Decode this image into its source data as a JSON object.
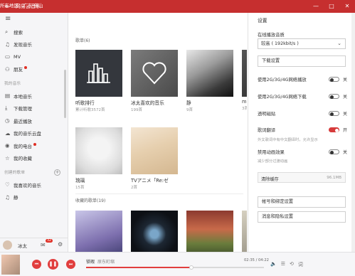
{
  "titlebar": {
    "back": "←",
    "title": "网易云音乐",
    "region": "所在地区：广东·佛山",
    "min": "—",
    "max": "□",
    "close": "✕"
  },
  "sidebar": {
    "items": [
      {
        "icon": "⌕",
        "label": "搜索"
      },
      {
        "icon": "♫",
        "label": "发现音乐"
      },
      {
        "icon": "▭",
        "label": "MV"
      },
      {
        "icon": "⚇",
        "label": "朋友",
        "dot": true
      }
    ],
    "my_music_header": "我的音乐",
    "my_music": [
      {
        "icon": "▤",
        "label": "本地音乐"
      },
      {
        "icon": "⤓",
        "label": "下载管理"
      },
      {
        "icon": "◷",
        "label": "最近播放"
      },
      {
        "icon": "☁",
        "label": "我的音乐云盘"
      },
      {
        "icon": "◉",
        "label": "我的电台",
        "dot": true
      },
      {
        "icon": "☆",
        "label": "我的收藏"
      }
    ],
    "playlist_header": "创建的歌单",
    "playlists": [
      {
        "icon": "♡",
        "label": "我喜欢的音乐"
      },
      {
        "icon": "♫",
        "label": "静"
      }
    ],
    "user": {
      "name": "冰太",
      "badge": "32"
    }
  },
  "main": {
    "section1_title": "歌单(6)",
    "cards": [
      {
        "name": "听歌排行",
        "count": "累计听歌3572首"
      },
      {
        "name": "冰太喜欢的音乐",
        "count": "199首"
      },
      {
        "name": "静",
        "count": "9首"
      },
      {
        "name": "mp",
        "count": "3首"
      },
      {
        "name": "琉璃",
        "count": "15首"
      },
      {
        "name": "TVアニメ「Re:ゼ",
        "count": "2首"
      }
    ],
    "section2_title": "收藏的歌单(19)"
  },
  "settings": {
    "header": "设置",
    "quality_label": "在线播放音质",
    "quality_value": "较高 ( 192kbit/s )",
    "download_button": "下载设置",
    "toggles": [
      {
        "label": "使用2G/3G/4G网络播放",
        "state": "关",
        "on": false
      },
      {
        "label": "使用2G/3G/4G网络下载",
        "state": "关",
        "on": false
      },
      {
        "label": "透明磁贴",
        "state": "关",
        "on": false
      },
      {
        "label": "歌词翻译",
        "state": "开",
        "on": true
      },
      {
        "label": "禁用动画效果",
        "state": "关",
        "on": false
      }
    ],
    "translate_sub": "外文歌词中有中文翻译时，允许显示",
    "anim_sub": "减少部分过渡动画",
    "clear_cache": "清除缓存",
    "cache_size": "96.1MB",
    "account_button": "帐号和绑定设置",
    "privacy_button": "消息和隐私设置"
  },
  "player": {
    "song": "锁瑕",
    "artist": "原东町缩",
    "time": "02:35 / 04:22",
    "progress": 0.59,
    "colors": {
      "accent": "#e13e3e",
      "brand": "#c62f2f"
    }
  }
}
